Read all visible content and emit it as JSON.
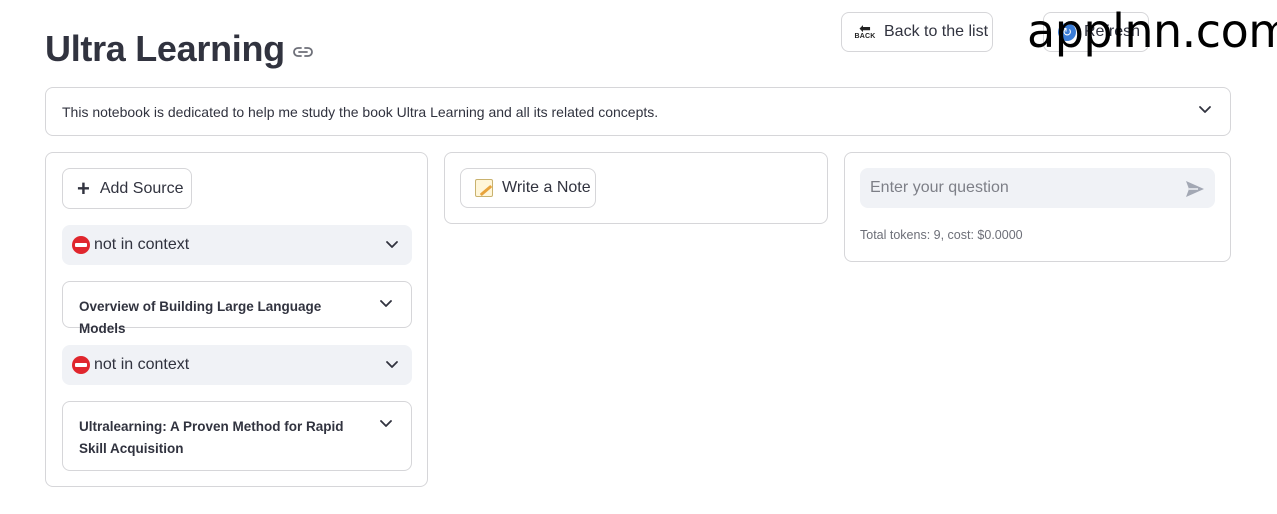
{
  "header": {
    "title": "Ultra Learning",
    "back_label": "Back to the list",
    "back_icon_text": "BACK",
    "refresh_label": "Refresh"
  },
  "watermark": "applnn.com",
  "description": "This notebook is dedicated to help me study the book Ultra Learning and all its related concepts.",
  "sources_panel": {
    "add_source_label": "Add Source",
    "items": [
      {
        "status": "not in context",
        "title": "Overview of Building Large Language Models"
      },
      {
        "status": "not in context",
        "title": "Ultralearning: A Proven Method for Rapid Skill Acquisition"
      }
    ]
  },
  "notes_panel": {
    "write_note_label": "Write a Note"
  },
  "chat_panel": {
    "input_placeholder": "Enter your question",
    "input_value": "",
    "tokens_text": "Total tokens: 9, cost: $0.0000"
  },
  "icons": {
    "link": "link-icon",
    "chevron": "chevron-down-icon",
    "no_entry": "no-entry-icon",
    "memo": "memo-icon",
    "send": "send-icon",
    "refresh": "refresh-icon",
    "back": "back-arrow-icon",
    "plus": "plus-icon"
  },
  "colors": {
    "text": "#31333f",
    "border": "#d6d6d9",
    "input_bg": "#f0f2f6",
    "no_entry_red": "#e0262d"
  }
}
